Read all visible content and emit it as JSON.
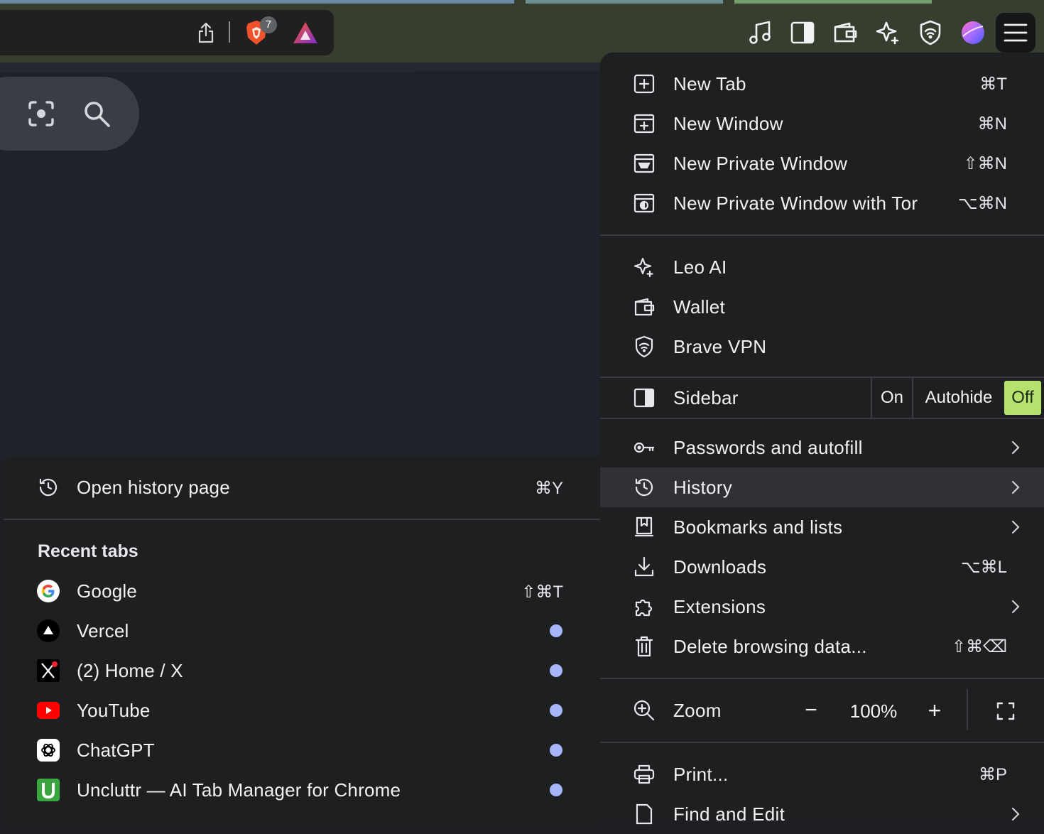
{
  "toolbar": {
    "shields_badge": "7",
    "icons": [
      "share-icon",
      "brave-shields-icon",
      "brave-rewards-icon",
      "music-icon",
      "sidebar-icon",
      "wallet-icon",
      "leo-icon",
      "vpn-icon",
      "profile-avatar",
      "menu-icon"
    ]
  },
  "menu": {
    "items": [
      {
        "label": "New Tab",
        "shortcut": "⌘T"
      },
      {
        "label": "New Window",
        "shortcut": "⌘N"
      },
      {
        "label": "New Private Window",
        "shortcut": "⇧⌘N"
      },
      {
        "label": "New Private Window with Tor",
        "shortcut": "⌥⌘N"
      },
      {
        "label": "Leo AI"
      },
      {
        "label": "Wallet"
      },
      {
        "label": "Brave VPN"
      },
      {
        "label": "Sidebar"
      },
      {
        "label": "Passwords and autofill"
      },
      {
        "label": "History"
      },
      {
        "label": "Bookmarks and lists"
      },
      {
        "label": "Downloads",
        "shortcut": "⌥⌘L"
      },
      {
        "label": "Extensions"
      },
      {
        "label": "Delete browsing data...",
        "shortcut": "⇧⌘⌫"
      },
      {
        "label": "Zoom"
      },
      {
        "label": "Print...",
        "shortcut": "⌘P"
      },
      {
        "label": "Find and Edit"
      }
    ],
    "sidebar_options": {
      "on": "On",
      "autohide": "Autohide",
      "off": "Off",
      "selected": "Off"
    },
    "zoom": {
      "minus": "−",
      "value": "100%",
      "plus": "+"
    },
    "colors": {
      "selected_option": "#b5e26f",
      "highlight": "#303135"
    }
  },
  "history_menu": {
    "open_history": {
      "label": "Open history page",
      "shortcut": "⌘Y"
    },
    "recent_header": "Recent tabs",
    "tabs": [
      {
        "label": "Google",
        "shortcut": "⇧⌘T"
      },
      {
        "label": "Vercel"
      },
      {
        "label": "(2) Home / X"
      },
      {
        "label": "YouTube"
      },
      {
        "label": "ChatGPT"
      },
      {
        "label": "Uncluttr — AI Tab Manager for Chrome"
      }
    ]
  }
}
